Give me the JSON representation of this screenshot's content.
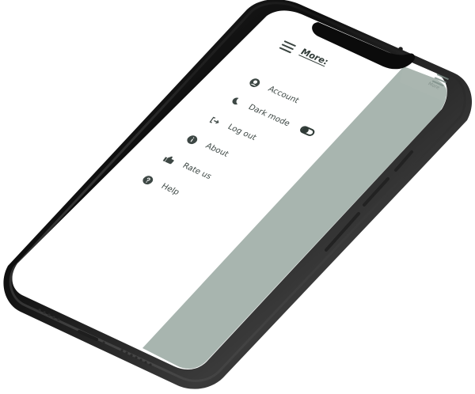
{
  "screen": {
    "colors": {
      "panel_bg": "#a8b5af",
      "menu_bg": "#ffffff",
      "text": "#3d4744"
    }
  },
  "menu": {
    "title": "More:",
    "items": [
      {
        "label": "Account",
        "icon": "user-circle-icon"
      },
      {
        "label": "Dark mode",
        "icon": "moon-icon",
        "has_toggle": true,
        "toggle_state": "off"
      },
      {
        "label": "Log out",
        "icon": "logout-icon"
      },
      {
        "label": "About",
        "icon": "info-icon"
      },
      {
        "label": "Rate us",
        "icon": "thumbs-up-icon"
      },
      {
        "label": "Help",
        "icon": "help-icon"
      }
    ]
  },
  "panel": {
    "label": "More"
  }
}
